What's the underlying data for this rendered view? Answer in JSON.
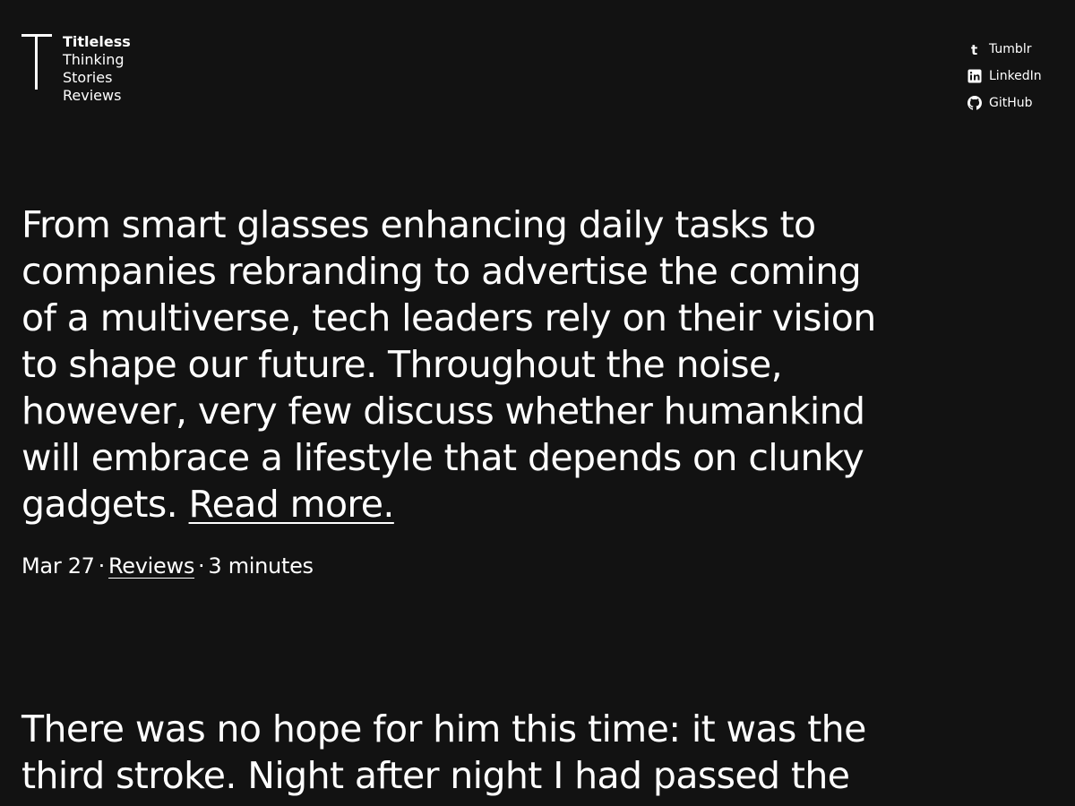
{
  "nav": {
    "site_title": "Titleless",
    "links": [
      "Thinking",
      "Stories",
      "Reviews"
    ]
  },
  "social": {
    "tumblr": "Tumblr",
    "linkedin": "LinkedIn",
    "github": "GitHub"
  },
  "posts": [
    {
      "excerpt": "From smart glasses enhancing daily tasks to companies rebranding to advertise the coming of a multiverse, tech leaders rely on their vision to shape our future. Throughout the noise, however, very few discuss whether humankind will embrace a lifestyle that depends on clunky gadgets.",
      "read_more": "Read more.",
      "date": "Mar 27",
      "category": "Reviews",
      "reading_time": "3 minutes"
    },
    {
      "excerpt": "There was no hope for him this time: it was the third stroke. Night after night I had passed the"
    }
  ],
  "colors": {
    "background": "#121212",
    "text": "#ffffff"
  }
}
